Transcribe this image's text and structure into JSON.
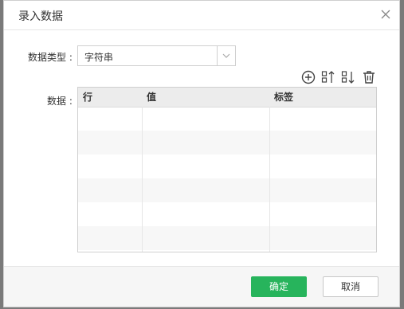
{
  "dialog": {
    "title": "录入数据",
    "close_icon": "close-icon"
  },
  "form": {
    "type_label": "数据类型 :",
    "type_value": "字符串",
    "data_label": "数据 :"
  },
  "toolbar": {
    "icons": [
      "add-circle-icon",
      "sort-ascending-icon",
      "sort-descending-icon",
      "trash-icon"
    ]
  },
  "table": {
    "columns": [
      "行",
      "值",
      "标签"
    ],
    "rows": []
  },
  "footer": {
    "ok_label": "确定",
    "cancel_label": "取消"
  },
  "colors": {
    "primary": "#27b45c",
    "header_bg": "#ececec"
  }
}
